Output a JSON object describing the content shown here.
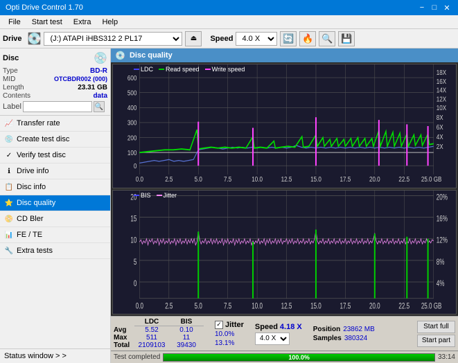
{
  "titlebar": {
    "title": "Opti Drive Control 1.70",
    "minimize": "−",
    "maximize": "□",
    "close": "✕"
  },
  "menu": {
    "items": [
      "File",
      "Start test",
      "Extra",
      "Help"
    ]
  },
  "drive_bar": {
    "label": "Drive",
    "drive_value": "(J:) ATAPI iHBS312  2 PL17",
    "speed_label": "Speed",
    "speed_value": "4.0 X"
  },
  "disc": {
    "header": "Disc",
    "type_label": "Type",
    "type_value": "BD-R",
    "mid_label": "MID",
    "mid_value": "OTCBDR002 (000)",
    "length_label": "Length",
    "length_value": "23.31 GB",
    "contents_label": "Contents",
    "contents_value": "data",
    "label_label": "Label"
  },
  "nav": {
    "items": [
      {
        "id": "transfer-rate",
        "label": "Transfer rate",
        "icon": "📈"
      },
      {
        "id": "create-test-disc",
        "label": "Create test disc",
        "icon": "💿"
      },
      {
        "id": "verify-test-disc",
        "label": "Verify test disc",
        "icon": "✓"
      },
      {
        "id": "drive-info",
        "label": "Drive info",
        "icon": "ℹ"
      },
      {
        "id": "disc-info",
        "label": "Disc info",
        "icon": "📋"
      },
      {
        "id": "disc-quality",
        "label": "Disc quality",
        "icon": "⭐",
        "active": true
      },
      {
        "id": "cd-bler",
        "label": "CD Bler",
        "icon": "📀"
      },
      {
        "id": "fe-te",
        "label": "FE / TE",
        "icon": "📊"
      },
      {
        "id": "extra-tests",
        "label": "Extra tests",
        "icon": "🔧"
      }
    ],
    "status_window": "Status window > >"
  },
  "disc_quality": {
    "title": "Disc quality",
    "legend": {
      "ldc_label": "LDC",
      "ldc_color": "#0000ff",
      "read_label": "Read speed",
      "read_color": "#00cc00",
      "write_label": "Write speed",
      "write_color": "#ff00ff"
    },
    "legend2": {
      "bis_label": "BIS",
      "bis_color": "#0000ff",
      "jitter_label": "Jitter",
      "jitter_color": "#ff88ff"
    }
  },
  "stats": {
    "headers": [
      "",
      "LDC",
      "BIS"
    ],
    "jitter_label": "Jitter",
    "jitter_checked": true,
    "speed_label": "Speed",
    "speed_value": "4.18 X",
    "speed_option": "4.0 X",
    "rows": [
      {
        "label": "Avg",
        "ldc": "5.52",
        "bis": "0.10",
        "jitter": "10.0%"
      },
      {
        "label": "Max",
        "ldc": "511",
        "bis": "11",
        "jitter": "13.1%"
      },
      {
        "label": "Total",
        "ldc": "2109103",
        "bis": "39430",
        "jitter": ""
      }
    ],
    "position_label": "Position",
    "position_value": "23862 MB",
    "samples_label": "Samples",
    "samples_value": "380324",
    "start_full_btn": "Start full",
    "start_part_btn": "Start part"
  },
  "progress": {
    "value": 100,
    "percent_text": "100.0%",
    "status_text": "Test completed",
    "time_text": "33:14"
  },
  "chart1": {
    "x_labels": [
      "0.0",
      "2.5",
      "5.0",
      "7.5",
      "10.0",
      "12.5",
      "15.0",
      "17.5",
      "20.0",
      "22.5",
      "25.0 GB"
    ],
    "y_labels_left": [
      "600",
      "500",
      "400",
      "300",
      "200",
      "100",
      "0"
    ],
    "y_labels_right": [
      "18X",
      "16X",
      "14X",
      "12X",
      "10X",
      "8X",
      "6X",
      "4X",
      "2X",
      ""
    ]
  },
  "chart2": {
    "x_labels": [
      "0.0",
      "2.5",
      "5.0",
      "7.5",
      "10.0",
      "12.5",
      "15.0",
      "17.5",
      "20.0",
      "22.5",
      "25.0 GB"
    ],
    "y_labels_left": [
      "20",
      "15",
      "10",
      "5",
      "0"
    ],
    "y_labels_right": [
      "20%",
      "16%",
      "12%",
      "8%",
      "4%",
      ""
    ]
  }
}
